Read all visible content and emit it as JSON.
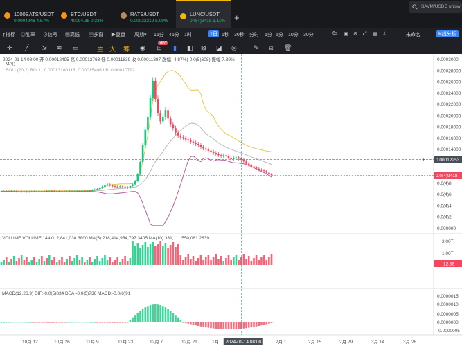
{
  "tabs": [
    {
      "symbol": "1000SATS/USDT",
      "price": "0.0004948",
      "change": "4.57%",
      "icon_color": "#f7931a"
    },
    {
      "symbol": "BTC/USDT",
      "price": "40094.88",
      "change": "0.33%",
      "icon_color": "#f7931a"
    },
    {
      "symbol": "RATS/USDT",
      "price": "0.00022212",
      "change": "5.09%",
      "icon_color": "#b98b5a"
    },
    {
      "symbol": "LUNC/USDT",
      "price": "0.0(4)9418",
      "change": "1.11%",
      "icon_color": "#f0b90b"
    }
  ],
  "add_tab": "+",
  "search": {
    "placeholder": "SAVM/USDC unisw"
  },
  "toolbar": {
    "indicators": "指标",
    "hot": "胜率",
    "signals": "信号",
    "high_low": "高低",
    "multi": "多窗",
    "replay": "复盘",
    "period": "周期",
    "intervals": [
      "15分",
      "45分",
      "1时",
      "1日",
      "1秒",
      "30秒",
      "分时",
      "1分",
      "5分",
      "10分",
      "30分"
    ],
    "active_interval": "1日",
    "right": [
      "6s",
      "未命名",
      "K线分析"
    ]
  },
  "drawbar": {
    "items": [
      "主",
      "大",
      "筹"
    ],
    "badge": "NEW"
  },
  "legend": {
    "ohlc": "2024-01-14 08:00  开 0.00012495  高 0.00012763  低 0.00011839  收 0.00011887  涨幅 -4.87%(-0.0(5)608)  振幅 7.39%",
    "ma": "MA()",
    "boll": "BOLL(20,2)  BOLL: 0.00013180  UB: 0.00015406  LB: 0.00010792"
  },
  "price_axis": [
    "0.0003000",
    "0.00028000",
    "0.00026000",
    "0.00024000",
    "0.00022000",
    "0.00020000",
    "0.00018000",
    "0.00016000",
    "0.00014000",
    "0.00012253",
    "0.0(4)9418",
    "0.0(4)8",
    "0.0(4)6",
    "0.0(4)4",
    "0.0(4)2",
    "0.000000"
  ],
  "crosshair_price": "0.00012253",
  "last_price_label": "0.0(4)9418",
  "volume_legend": "VOLUME   VOLUME:144,012,841,038.3800   MA(5):218,414,954,797.3405   MA(10):331,111,550,081.2839",
  "volume_axis": [
    "2.00T",
    "1.00T"
  ],
  "volume_last": "12.56",
  "macd_legend": "MACD(12,26,9)   DIF:-0.0(5)834   DEA:-0.0(5)736   MACD:-0.0(6)91",
  "macd_axis": [
    "0.0000015",
    "0.0000010",
    "0.0000005",
    "0.0000000",
    "-0.0000005"
  ],
  "x_axis": [
    "10月 12",
    "10月 26",
    "11月 9",
    "11月 23",
    "12月 7",
    "12月 21",
    "1月",
    "2月 1",
    "2月 15",
    "2月 29",
    "3月 14",
    "3月 28"
  ],
  "crosshair_date": "2024-01-14 08:00",
  "colors": {
    "up": "#0ecb81",
    "down": "#f6465d",
    "accent": "#3b82f6",
    "boll_mid": "#b9b9b9",
    "boll_up": "#e6c74a",
    "boll_low": "#b45aa0"
  },
  "chart_data": {
    "type": "candlestick",
    "closes": [
      6.58e-05,
      6.6e-05,
      6.55e-05,
      6.62e-05,
      6.58e-05,
      6.6e-05,
      6.54e-05,
      6.5e-05,
      6.56e-05,
      6.52e-05,
      6.5e-05,
      6.55e-05,
      6.58e-05,
      6.56e-05,
      6.6e-05,
      6.62e-05,
      6.58e-05,
      6.64e-05,
      6.6e-05,
      6.66e-05,
      6.63e-05,
      6.6e-05,
      6.64e-05,
      6.62e-05,
      6.58e-05,
      6.55e-05,
      6.6e-05,
      6.58e-05,
      6.62e-05,
      6.65e-05,
      6.68e-05,
      6.64e-05,
      6.7e-05,
      6.66e-05,
      6.72e-05,
      6.68e-05,
      6.8e-05,
      6.9e-05,
      7e-05,
      7.2e-05,
      7.4e-05,
      7.7e-05,
      7.8e-05,
      7.6e-05,
      7.5e-05,
      7.4e-05,
      7.35e-05,
      7.45e-05,
      7.4e-05,
      7.3e-05,
      7.2e-05,
      7.5e-05,
      7.8e-05,
      8.4e-05,
      9.6e-05,
      0.000118,
      0.000148,
      0.000175,
      0.000198,
      0.000232,
      0.000262,
      0.00023,
      0.000205,
      0.00019,
      0.000198,
      0.00021,
      0.000195,
      0.000185,
      0.000178,
      0.00017,
      0.000165,
      0.000162,
      0.00016,
      0.000158,
      0.000156,
      0.000154,
      0.000152,
      0.00015,
      0.000148,
      0.000145,
      0.000142,
      0.00014,
      0.000138,
      0.000136,
      0.000134,
      0.000132,
      0.00013,
      0.000128,
      0.00013,
      0.000128,
      0.000125,
      0.000123,
      0.000125,
      0.000126,
      0.000124,
      0.000122,
      0.0001189,
      0.000115,
      0.000112,
      0.00011,
      0.000108,
      0.000106,
      0.000104,
      0.000103,
      0.000102,
      9.9e-05,
      9.6e-05,
      9.42e-05
    ]
  }
}
